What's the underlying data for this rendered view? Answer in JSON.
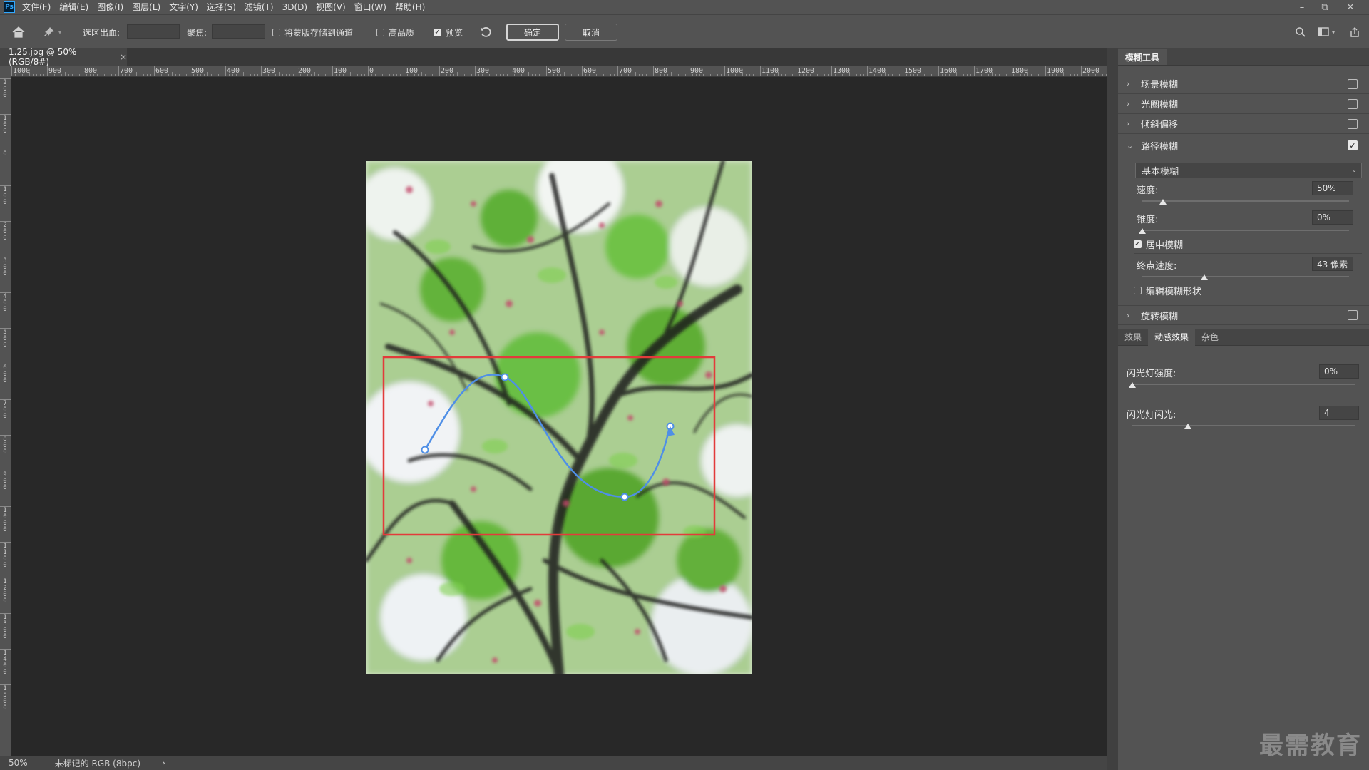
{
  "app": {
    "logo": "Ps"
  },
  "menu": [
    "文件(F)",
    "编辑(E)",
    "图像(I)",
    "图层(L)",
    "文字(Y)",
    "选择(S)",
    "滤镜(T)",
    "3D(D)",
    "视图(V)",
    "窗口(W)",
    "帮助(H)"
  ],
  "window_controls": {
    "minimize": "–",
    "restore": "⧉",
    "close": "✕"
  },
  "options_bar": {
    "selection_out_label": "选区出血:",
    "focus_label": "聚焦:",
    "save_mask_label": "将蒙版存储到通道",
    "save_mask_checked": false,
    "high_quality_label": "高品质",
    "high_quality_checked": false,
    "preview_label": "预览",
    "preview_checked": true,
    "ok_label": "确定",
    "cancel_label": "取消"
  },
  "document": {
    "tab_title": "1.25.jpg @ 50%(RGB/8#)",
    "close_glyph": "×"
  },
  "ruler": {
    "h_labels": [
      "1000",
      "900",
      "800",
      "700",
      "600",
      "500",
      "400",
      "300",
      "200",
      "100",
      "0",
      "100",
      "200",
      "300",
      "400",
      "500",
      "600",
      "700",
      "800",
      "900",
      "1000",
      "1100",
      "1200",
      "1300",
      "1400",
      "1500",
      "1600",
      "1700",
      "1800",
      "1900",
      "2000"
    ],
    "v_labels": [
      "2\n0\n0",
      "1\n0\n0",
      "0",
      "1\n0\n0",
      "2\n0\n0",
      "3\n0\n0",
      "4\n0\n0",
      "5\n0\n0",
      "6\n0\n0",
      "7\n0\n0",
      "8\n0\n0",
      "9\n0\n0",
      "1\n0\n0\n0",
      "1\n1\n0\n0",
      "1\n2\n0\n0",
      "1\n3\n0\n0",
      "1\n4\n0\n0",
      "1\n5\n0\n0"
    ]
  },
  "status": {
    "zoom": "50%",
    "profile": "未标记的 RGB (8bpc)",
    "arrow": "›"
  },
  "blur_panel": {
    "title": "模糊工具",
    "collapse_glyph": "»",
    "sections": [
      {
        "label": "场景模糊",
        "checked": false,
        "expanded": false
      },
      {
        "label": "光圈模糊",
        "checked": false,
        "expanded": false
      },
      {
        "label": "倾斜偏移",
        "checked": false,
        "expanded": false
      },
      {
        "label": "路径模糊",
        "checked": true,
        "expanded": true
      },
      {
        "label": "旋转模糊",
        "checked": false,
        "expanded": false
      }
    ],
    "path_blur": {
      "mode": "基本模糊",
      "speed_label": "速度:",
      "speed_value": "50%",
      "speed_level": 0.5,
      "taper_label": "锥度:",
      "taper_value": "0%",
      "taper_level": 0.0,
      "centered_label": "居中模糊",
      "centered_checked": true,
      "end_speed_label": "终点速度:",
      "end_speed_value": "43 像素",
      "end_speed_level": 0.3,
      "edit_shape_label": "编辑模糊形状",
      "edit_shape_checked": false
    },
    "sub_tabs": [
      {
        "label": "效果",
        "active": false
      },
      {
        "label": "动感效果",
        "active": true
      },
      {
        "label": "杂色",
        "active": false
      }
    ],
    "motion": {
      "strobe_strength_label": "闪光灯强度:",
      "strobe_strength_value": "0%",
      "strobe_strength_level": 0.0,
      "strobe_flashes_label": "闪光灯闪光:",
      "strobe_flashes_value": "4",
      "strobe_flashes_level": 0.25
    }
  },
  "watermark": "最需教育",
  "colors": {
    "accent_path": "#4f8fe6",
    "selection_rect": "#e23b3b",
    "ui_bg": "#535353",
    "canvas_bg": "#282828"
  }
}
